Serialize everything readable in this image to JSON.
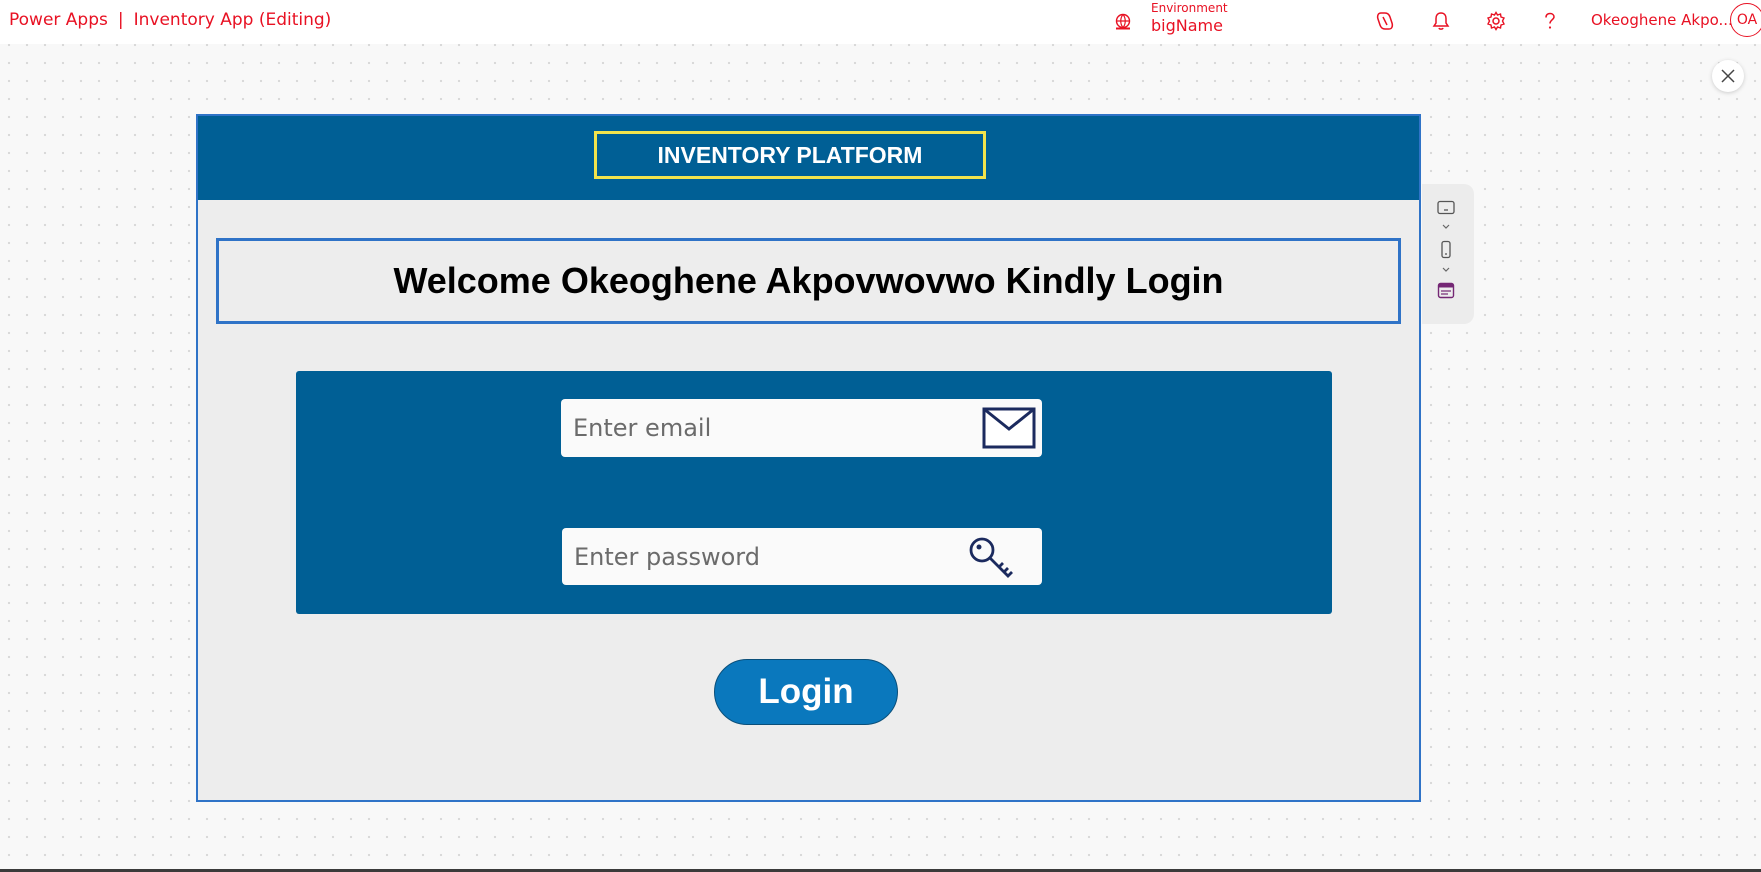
{
  "topbar": {
    "app_name": "Power Apps",
    "separator": "|",
    "document_title": "Inventory App (Editing)",
    "environment_label": "Environment",
    "environment_name": "bigName",
    "user_name": "Okeoghene Akpo...",
    "avatar_initials": "OA",
    "accent_color": "#e81123",
    "icons": [
      "environment-icon",
      "copilot-icon",
      "bell-icon",
      "gear-icon",
      "help-icon"
    ]
  },
  "canvas": {
    "close_icon": "close-icon",
    "side_tools": [
      "desktop-view-icon",
      "chevron-down-icon",
      "phone-view-icon",
      "chevron-down-icon",
      "screen-layout-icon"
    ]
  },
  "app": {
    "header_color": "#005f95",
    "platform_title": "INVENTORY PLATFORM",
    "welcome_text": "Welcome Okeoghene Akpovwovwo Kindly Login",
    "email": {
      "value": "",
      "placeholder": "Enter email",
      "icon": "mail-icon"
    },
    "password": {
      "value": "",
      "placeholder": "Enter password",
      "icon": "key-icon"
    },
    "login_label": "Login",
    "login_color": "#0a78bd"
  }
}
